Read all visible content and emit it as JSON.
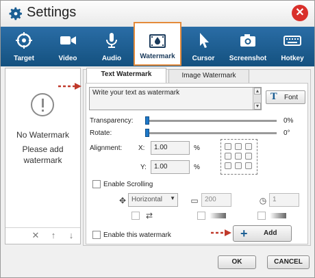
{
  "window": {
    "title": "Settings"
  },
  "tabs": [
    {
      "label": "Target",
      "icon": "target-icon"
    },
    {
      "label": "Video",
      "icon": "video-camera-icon"
    },
    {
      "label": "Audio",
      "icon": "microphone-icon"
    },
    {
      "label": "Watermark",
      "icon": "watermark-icon",
      "active": true
    },
    {
      "label": "Cursor",
      "icon": "cursor-icon"
    },
    {
      "label": "Screenshot",
      "icon": "camera-icon"
    },
    {
      "label": "Hotkey",
      "icon": "keyboard-icon"
    }
  ],
  "left_panel": {
    "empty_title": "No Watermark",
    "empty_hint": "Please add watermark"
  },
  "subtabs": {
    "text": "Text Watermark",
    "image": "Image Watermark"
  },
  "text_box": {
    "value": "Write your text as watermark"
  },
  "font_button": "Font",
  "transparency": {
    "label": "Transparency:",
    "value": "0%",
    "level": 0
  },
  "rotate": {
    "label": "Rotate:",
    "value": "0°",
    "level": 0
  },
  "alignment": {
    "label": "Alignment:",
    "x_label": "X:",
    "x_value": "1.00",
    "x_unit": "%",
    "y_label": "Y:",
    "y_value": "1.00",
    "y_unit": "%"
  },
  "scrolling": {
    "label": "Enable Scrolling",
    "direction": "Horizontal",
    "speed": "200",
    "delay": "1"
  },
  "enable_watermark": "Enable this watermark",
  "add_button": "Add",
  "footer": {
    "ok": "OK",
    "cancel": "CANCEL"
  },
  "colors": {
    "accent": "#1b5e93",
    "tabbar": "#1c5d8f",
    "close": "#d9302b",
    "arrow": "#c0392b",
    "active_border": "#e48a3a"
  }
}
